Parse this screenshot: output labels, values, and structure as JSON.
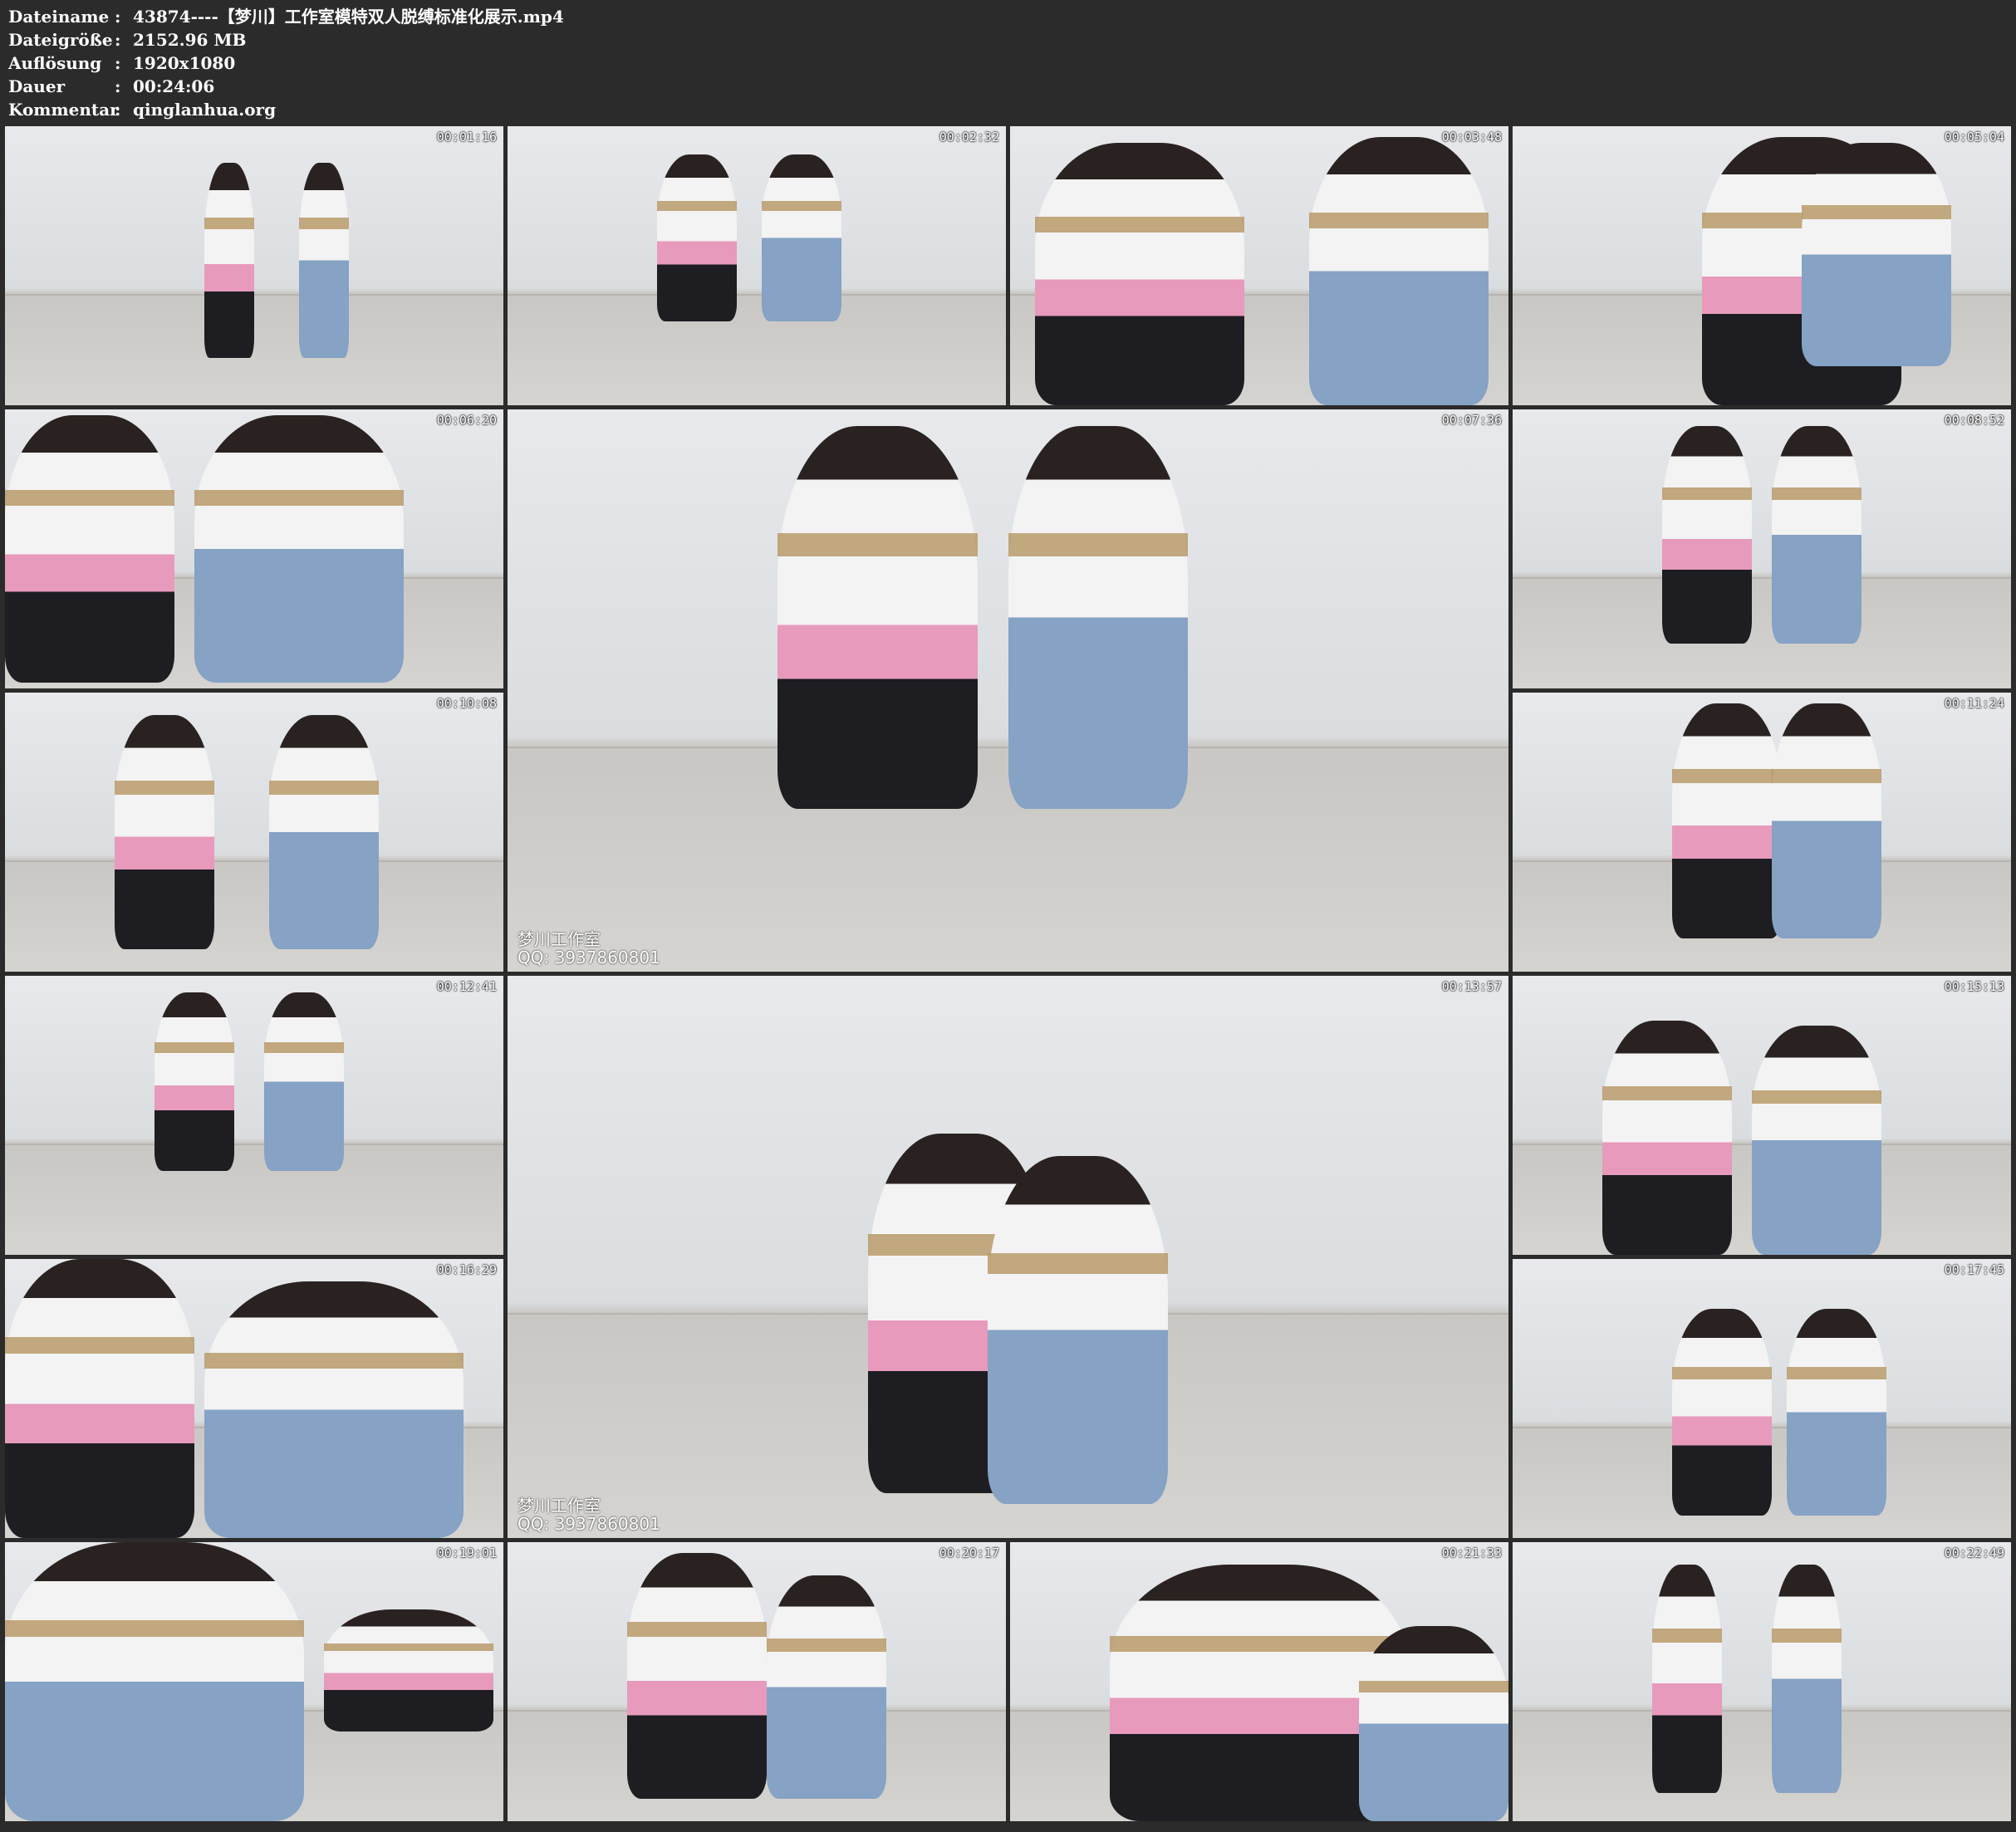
{
  "info": [
    {
      "label": "Dateiname",
      "value": "43874----【梦川】工作室模特双人脱缚标准化展示.mp4"
    },
    {
      "label": "Dateigröße",
      "value": "2152.96 MB"
    },
    {
      "label": "Auflösung",
      "value": "1920x1080"
    },
    {
      "label": "Dauer",
      "value": "00:24:06"
    },
    {
      "label": "Kommentar",
      "value": "qinglanhua.org"
    }
  ],
  "separator": ":",
  "thumbnails": [
    {
      "timestamp": "00:01:16"
    },
    {
      "timestamp": "00:02:32"
    },
    {
      "timestamp": "00:03:48"
    },
    {
      "timestamp": "00:05:04"
    },
    {
      "timestamp": "00:06:20"
    },
    {
      "timestamp": "00:07:36",
      "watermark": [
        "梦川工作室",
        "QQ: 3937860801"
      ]
    },
    {
      "timestamp": "00:08:52"
    },
    {
      "timestamp": "00:10:08"
    },
    {
      "timestamp": "00:11:24"
    },
    {
      "timestamp": "00:12:41"
    },
    {
      "timestamp": "00:13:57",
      "watermark": [
        "梦川工作室",
        "QQ: 3937860801"
      ]
    },
    {
      "timestamp": "00:15:13"
    },
    {
      "timestamp": "00:16:29"
    },
    {
      "timestamp": "00:17:45"
    },
    {
      "timestamp": "00:19:01"
    },
    {
      "timestamp": "00:20:17"
    },
    {
      "timestamp": "00:21:33"
    },
    {
      "timestamp": "00:22:49"
    }
  ]
}
